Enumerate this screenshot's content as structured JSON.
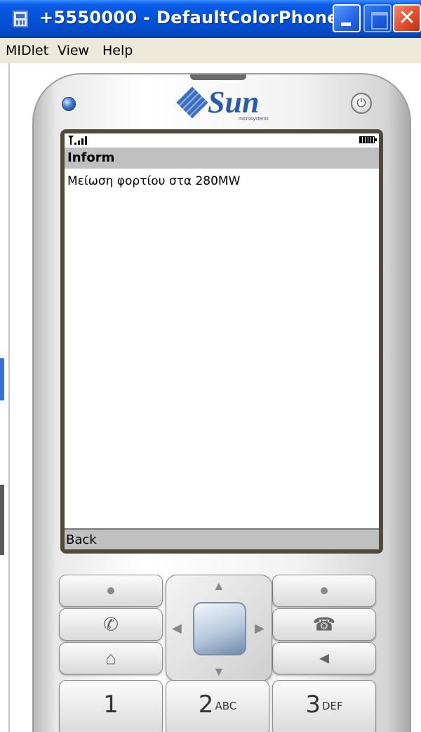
{
  "window": {
    "title": "+5550000 - DefaultColorPhone",
    "close_glyph": "✕"
  },
  "menubar": {
    "items": [
      "MIDlet",
      "View",
      "Help"
    ]
  },
  "phone": {
    "brand": "Sun",
    "brand_sub": "microsystems",
    "power_glyph": "⏻"
  },
  "screen": {
    "title": "Inform",
    "message": "Μείωση φορτίου στα 280MW",
    "softkey_left": "Back"
  },
  "keypad": {
    "call_glyph": "✆",
    "end_glyph": "☎",
    "home_glyph": "⌂",
    "clear_glyph": "◀",
    "nav_up": "▲",
    "nav_down": "▼",
    "nav_left": "◀",
    "nav_right": "▶",
    "numbers": [
      {
        "digit": "1",
        "letters": ""
      },
      {
        "digit": "2",
        "letters": "ABC"
      },
      {
        "digit": "3",
        "letters": "DEF"
      }
    ]
  },
  "colors": {
    "titlebar": "#0552d6",
    "menubar": "#ece9d8",
    "screen_bar": "#c0c0c0"
  }
}
